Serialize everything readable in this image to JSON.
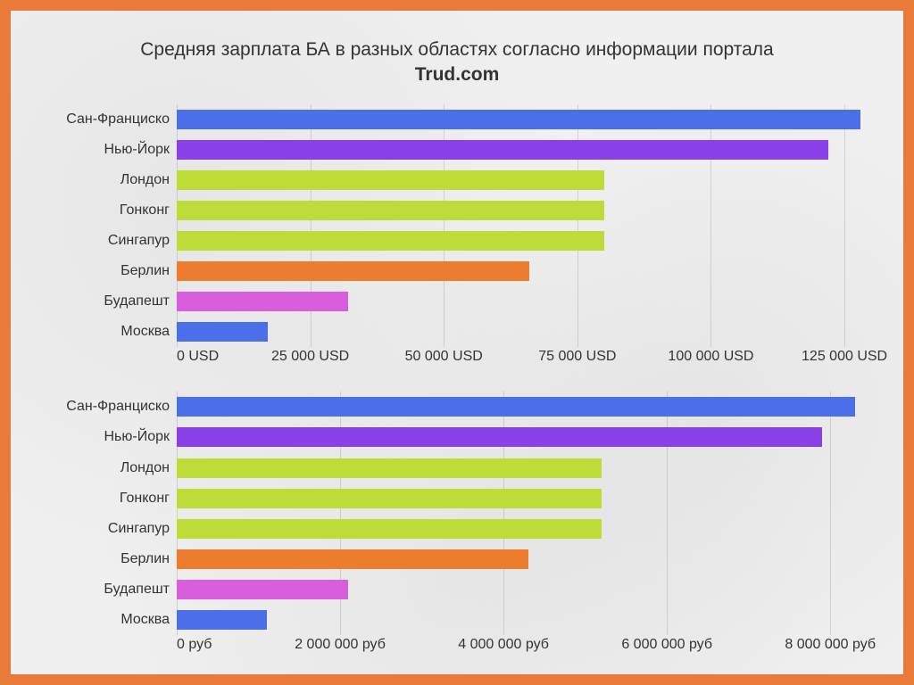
{
  "title_line1": "Средняя зарплата БА в разных областях согласно информации портала",
  "title_line2": "Trud.com",
  "chart_data": [
    {
      "type": "bar",
      "orientation": "horizontal",
      "title": "",
      "xlabel": "",
      "ylabel": "",
      "xlim": [
        0,
        130000
      ],
      "unit": "USD",
      "categories": [
        "Сан-Франциско",
        "Нью-Йорк",
        "Лондон",
        "Гонконг",
        "Сингапур",
        "Берлин",
        "Будапешт",
        "Москва"
      ],
      "values": [
        128000,
        122000,
        80000,
        80000,
        80000,
        66000,
        32000,
        17000
      ],
      "colors": [
        "#4a6fe8",
        "#8a3fe8",
        "#bedc37",
        "#bedc37",
        "#bedc37",
        "#ee7c2f",
        "#d95edc",
        "#4a6fe8"
      ],
      "ticks": [
        0,
        25000,
        50000,
        75000,
        100000,
        125000
      ],
      "tick_labels": [
        "0 USD",
        "25 000 USD",
        "50 000 USD",
        "75 000 USD",
        "100 000 USD",
        "125 000 USD"
      ]
    },
    {
      "type": "bar",
      "orientation": "horizontal",
      "title": "",
      "xlabel": "",
      "ylabel": "",
      "xlim": [
        0,
        8500000
      ],
      "unit": "руб",
      "categories": [
        "Сан-Франциско",
        "Нью-Йорк",
        "Лондон",
        "Гонконг",
        "Сингапур",
        "Берлин",
        "Будапешт",
        "Москва"
      ],
      "values": [
        8300000,
        7900000,
        5200000,
        5200000,
        5200000,
        4300000,
        2100000,
        1100000
      ],
      "colors": [
        "#4a6fe8",
        "#8a3fe8",
        "#bedc37",
        "#bedc37",
        "#bedc37",
        "#ee7c2f",
        "#d95edc",
        "#4a6fe8"
      ],
      "ticks": [
        0,
        2000000,
        4000000,
        6000000,
        8000000
      ],
      "tick_labels": [
        "0 руб",
        "2 000 000 руб",
        "4 000 000 руб",
        "6 000 000 руб",
        "8 000 000 руб"
      ]
    }
  ]
}
